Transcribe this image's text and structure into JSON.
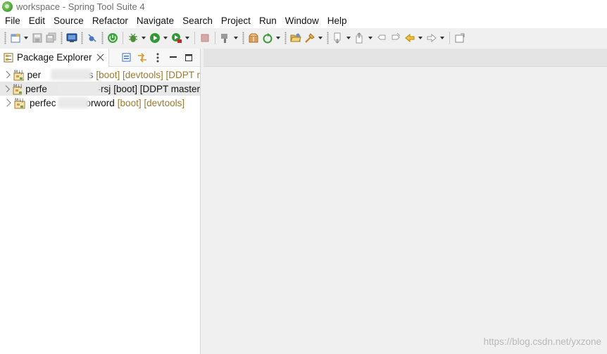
{
  "window": {
    "title": "workspace - Spring Tool Suite 4"
  },
  "menu": [
    "File",
    "Edit",
    "Source",
    "Refactor",
    "Navigate",
    "Search",
    "Project",
    "Run",
    "Window",
    "Help"
  ],
  "toolbar": {
    "icons": [
      "new-icon",
      "save-icon",
      "save-all-icon",
      "terminal-icon",
      "skip-breakpoints-icon",
      "boot-dashboard-icon",
      "debug-icon",
      "run-icon",
      "run-external-icon",
      "stop-icon",
      "build-icon",
      "new-java-package-icon",
      "refresh-icon",
      "open-type-icon",
      "search-icon",
      "next-annotation-icon",
      "prev-annotation-icon",
      "last-edit-icon",
      "back-icon",
      "forward-icon",
      "pin-editor-icon"
    ]
  },
  "package_explorer": {
    "tab_label": "Package Explorer",
    "projects": [
      {
        "name_start": "per",
        "name_end": "es",
        "decorations": "[boot] [devtools] [DDPT r",
        "deco_style": "muted",
        "selected": false
      },
      {
        "name_start": "perfe",
        "name_end": "a-rsj",
        "decorations": "[boot] [DDPT master",
        "deco_style": "dark",
        "selected": true
      },
      {
        "name_start": "perfec",
        "name_end": "orword",
        "decorations": "[boot] [devtools]",
        "deco_style": "muted",
        "selected": false
      }
    ]
  },
  "watermark": "https://blog.csdn.net/yxzone",
  "colors": {
    "decoration": "#9b7a30",
    "selection": "#e8e8e8",
    "chrome": "#f0f0f0"
  }
}
